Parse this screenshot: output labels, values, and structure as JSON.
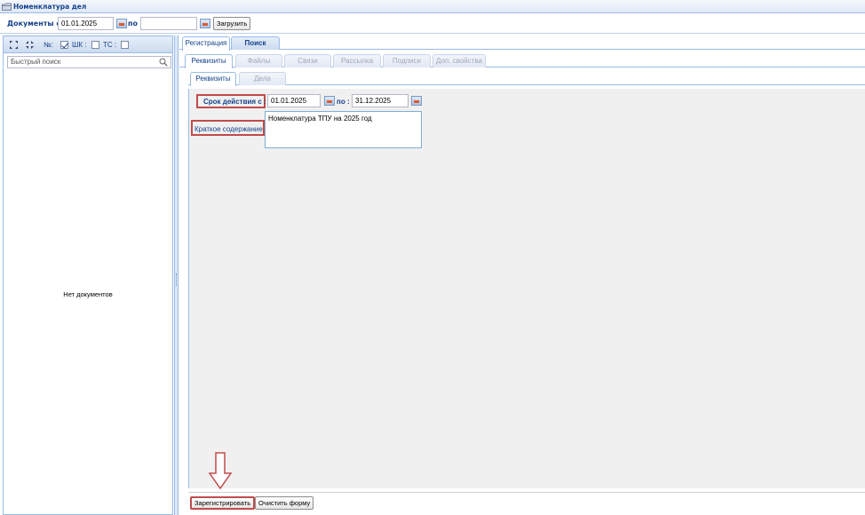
{
  "window": {
    "title": "Номенклатура дел"
  },
  "toolbar": {
    "docs_from_label": "Документы с :",
    "docs_from_value": "01.01.2025",
    "to_label": "по :",
    "to_value": "",
    "load_button": "Загрузить"
  },
  "left_panel": {
    "num_label": "№:",
    "num_checked": true,
    "shk_label": "ШК :",
    "shk_checked": false,
    "ts_label": "ТС :",
    "ts_checked": false,
    "search_placeholder": "Быстрый поиск",
    "empty_text": "Нет документов"
  },
  "tabs_main": [
    {
      "label": "Регистрация",
      "active": true
    },
    {
      "label": "Поиск",
      "active": false
    }
  ],
  "tabs_sub": [
    {
      "label": "Реквизиты",
      "active": true
    },
    {
      "label": "Файлы",
      "disabled": true
    },
    {
      "label": "Связи",
      "disabled": true
    },
    {
      "label": "Рассылка",
      "disabled": true
    },
    {
      "label": "Подписи",
      "disabled": true
    },
    {
      "label": "Доп. свойства",
      "disabled": true
    }
  ],
  "tabs_inner": [
    {
      "label": "Реквизиты",
      "active": true
    },
    {
      "label": "Дела",
      "disabled": true
    }
  ],
  "form": {
    "validity_label": "Срок действия с :",
    "validity_from": "01.01.2025",
    "validity_to_label": "по :",
    "validity_to": "31.12.2025",
    "summary_label": "Краткое содержание :",
    "summary_value": "Номенклатура ТПУ на 2025 год"
  },
  "actions": {
    "register_button": "Зарегистрировать",
    "clear_button": "Очистить форму"
  },
  "colors": {
    "highlight": "#c14b4b",
    "header_text": "#15428b",
    "border": "#99bbe8"
  }
}
